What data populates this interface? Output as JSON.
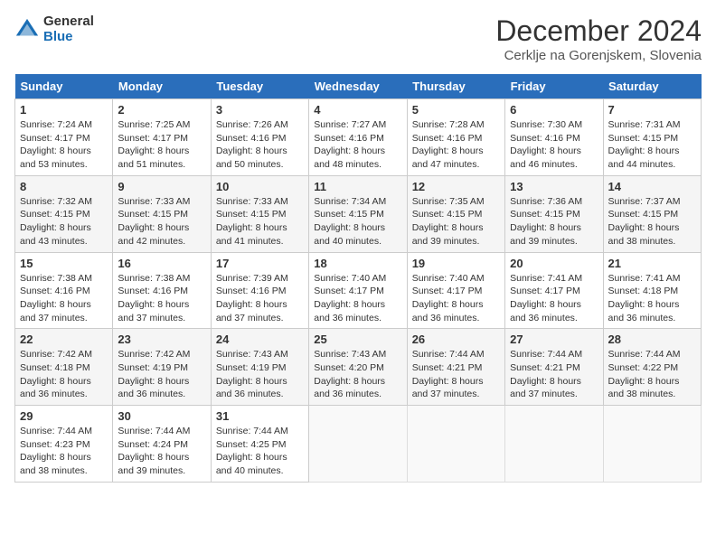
{
  "header": {
    "logo_general": "General",
    "logo_blue": "Blue",
    "title": "December 2024",
    "location": "Cerklje na Gorenjskem, Slovenia"
  },
  "days_of_week": [
    "Sunday",
    "Monday",
    "Tuesday",
    "Wednesday",
    "Thursday",
    "Friday",
    "Saturday"
  ],
  "weeks": [
    [
      {
        "day": 1,
        "sunrise": "Sunrise: 7:24 AM",
        "sunset": "Sunset: 4:17 PM",
        "daylight": "Daylight: 8 hours",
        "daylight2": "and 53 minutes."
      },
      {
        "day": 2,
        "sunrise": "Sunrise: 7:25 AM",
        "sunset": "Sunset: 4:17 PM",
        "daylight": "Daylight: 8 hours",
        "daylight2": "and 51 minutes."
      },
      {
        "day": 3,
        "sunrise": "Sunrise: 7:26 AM",
        "sunset": "Sunset: 4:16 PM",
        "daylight": "Daylight: 8 hours",
        "daylight2": "and 50 minutes."
      },
      {
        "day": 4,
        "sunrise": "Sunrise: 7:27 AM",
        "sunset": "Sunset: 4:16 PM",
        "daylight": "Daylight: 8 hours",
        "daylight2": "and 48 minutes."
      },
      {
        "day": 5,
        "sunrise": "Sunrise: 7:28 AM",
        "sunset": "Sunset: 4:16 PM",
        "daylight": "Daylight: 8 hours",
        "daylight2": "and 47 minutes."
      },
      {
        "day": 6,
        "sunrise": "Sunrise: 7:30 AM",
        "sunset": "Sunset: 4:16 PM",
        "daylight": "Daylight: 8 hours",
        "daylight2": "and 46 minutes."
      },
      {
        "day": 7,
        "sunrise": "Sunrise: 7:31 AM",
        "sunset": "Sunset: 4:15 PM",
        "daylight": "Daylight: 8 hours",
        "daylight2": "and 44 minutes."
      }
    ],
    [
      {
        "day": 8,
        "sunrise": "Sunrise: 7:32 AM",
        "sunset": "Sunset: 4:15 PM",
        "daylight": "Daylight: 8 hours",
        "daylight2": "and 43 minutes."
      },
      {
        "day": 9,
        "sunrise": "Sunrise: 7:33 AM",
        "sunset": "Sunset: 4:15 PM",
        "daylight": "Daylight: 8 hours",
        "daylight2": "and 42 minutes."
      },
      {
        "day": 10,
        "sunrise": "Sunrise: 7:33 AM",
        "sunset": "Sunset: 4:15 PM",
        "daylight": "Daylight: 8 hours",
        "daylight2": "and 41 minutes."
      },
      {
        "day": 11,
        "sunrise": "Sunrise: 7:34 AM",
        "sunset": "Sunset: 4:15 PM",
        "daylight": "Daylight: 8 hours",
        "daylight2": "and 40 minutes."
      },
      {
        "day": 12,
        "sunrise": "Sunrise: 7:35 AM",
        "sunset": "Sunset: 4:15 PM",
        "daylight": "Daylight: 8 hours",
        "daylight2": "and 39 minutes."
      },
      {
        "day": 13,
        "sunrise": "Sunrise: 7:36 AM",
        "sunset": "Sunset: 4:15 PM",
        "daylight": "Daylight: 8 hours",
        "daylight2": "and 39 minutes."
      },
      {
        "day": 14,
        "sunrise": "Sunrise: 7:37 AM",
        "sunset": "Sunset: 4:15 PM",
        "daylight": "Daylight: 8 hours",
        "daylight2": "and 38 minutes."
      }
    ],
    [
      {
        "day": 15,
        "sunrise": "Sunrise: 7:38 AM",
        "sunset": "Sunset: 4:16 PM",
        "daylight": "Daylight: 8 hours",
        "daylight2": "and 37 minutes."
      },
      {
        "day": 16,
        "sunrise": "Sunrise: 7:38 AM",
        "sunset": "Sunset: 4:16 PM",
        "daylight": "Daylight: 8 hours",
        "daylight2": "and 37 minutes."
      },
      {
        "day": 17,
        "sunrise": "Sunrise: 7:39 AM",
        "sunset": "Sunset: 4:16 PM",
        "daylight": "Daylight: 8 hours",
        "daylight2": "and 37 minutes."
      },
      {
        "day": 18,
        "sunrise": "Sunrise: 7:40 AM",
        "sunset": "Sunset: 4:17 PM",
        "daylight": "Daylight: 8 hours",
        "daylight2": "and 36 minutes."
      },
      {
        "day": 19,
        "sunrise": "Sunrise: 7:40 AM",
        "sunset": "Sunset: 4:17 PM",
        "daylight": "Daylight: 8 hours",
        "daylight2": "and 36 minutes."
      },
      {
        "day": 20,
        "sunrise": "Sunrise: 7:41 AM",
        "sunset": "Sunset: 4:17 PM",
        "daylight": "Daylight: 8 hours",
        "daylight2": "and 36 minutes."
      },
      {
        "day": 21,
        "sunrise": "Sunrise: 7:41 AM",
        "sunset": "Sunset: 4:18 PM",
        "daylight": "Daylight: 8 hours",
        "daylight2": "and 36 minutes."
      }
    ],
    [
      {
        "day": 22,
        "sunrise": "Sunrise: 7:42 AM",
        "sunset": "Sunset: 4:18 PM",
        "daylight": "Daylight: 8 hours",
        "daylight2": "and 36 minutes."
      },
      {
        "day": 23,
        "sunrise": "Sunrise: 7:42 AM",
        "sunset": "Sunset: 4:19 PM",
        "daylight": "Daylight: 8 hours",
        "daylight2": "and 36 minutes."
      },
      {
        "day": 24,
        "sunrise": "Sunrise: 7:43 AM",
        "sunset": "Sunset: 4:19 PM",
        "daylight": "Daylight: 8 hours",
        "daylight2": "and 36 minutes."
      },
      {
        "day": 25,
        "sunrise": "Sunrise: 7:43 AM",
        "sunset": "Sunset: 4:20 PM",
        "daylight": "Daylight: 8 hours",
        "daylight2": "and 36 minutes."
      },
      {
        "day": 26,
        "sunrise": "Sunrise: 7:44 AM",
        "sunset": "Sunset: 4:21 PM",
        "daylight": "Daylight: 8 hours",
        "daylight2": "and 37 minutes."
      },
      {
        "day": 27,
        "sunrise": "Sunrise: 7:44 AM",
        "sunset": "Sunset: 4:21 PM",
        "daylight": "Daylight: 8 hours",
        "daylight2": "and 37 minutes."
      },
      {
        "day": 28,
        "sunrise": "Sunrise: 7:44 AM",
        "sunset": "Sunset: 4:22 PM",
        "daylight": "Daylight: 8 hours",
        "daylight2": "and 38 minutes."
      }
    ],
    [
      {
        "day": 29,
        "sunrise": "Sunrise: 7:44 AM",
        "sunset": "Sunset: 4:23 PM",
        "daylight": "Daylight: 8 hours",
        "daylight2": "and 38 minutes."
      },
      {
        "day": 30,
        "sunrise": "Sunrise: 7:44 AM",
        "sunset": "Sunset: 4:24 PM",
        "daylight": "Daylight: 8 hours",
        "daylight2": "and 39 minutes."
      },
      {
        "day": 31,
        "sunrise": "Sunrise: 7:44 AM",
        "sunset": "Sunset: 4:25 PM",
        "daylight": "Daylight: 8 hours",
        "daylight2": "and 40 minutes."
      },
      null,
      null,
      null,
      null
    ]
  ]
}
